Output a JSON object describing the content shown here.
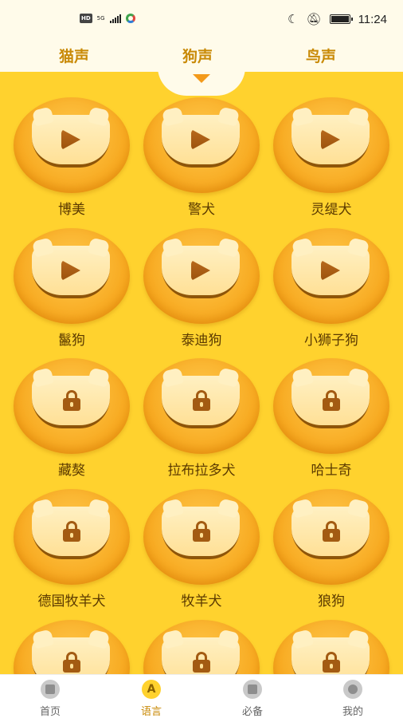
{
  "status_bar": {
    "left_badge": "HD",
    "network": "5G",
    "time": "11:24"
  },
  "tabs": [
    {
      "label": "猫声",
      "active": false
    },
    {
      "label": "狗声",
      "active": true
    },
    {
      "label": "鸟声",
      "active": false
    }
  ],
  "sounds": [
    {
      "label": "博美",
      "icon": "play-icon"
    },
    {
      "label": "警犬",
      "icon": "play-icon"
    },
    {
      "label": "灵缇犬",
      "icon": "play-icon"
    },
    {
      "label": "鬣狗",
      "icon": "play-icon"
    },
    {
      "label": "泰迪狗",
      "icon": "play-icon"
    },
    {
      "label": "小狮子狗",
      "icon": "play-icon"
    },
    {
      "label": "藏獒",
      "icon": "lock-icon"
    },
    {
      "label": "拉布拉多犬",
      "icon": "lock-icon"
    },
    {
      "label": "哈士奇",
      "icon": "lock-icon"
    },
    {
      "label": "德国牧羊犬",
      "icon": "lock-icon"
    },
    {
      "label": "牧羊犬",
      "icon": "lock-icon"
    },
    {
      "label": "狼狗",
      "icon": "lock-icon"
    },
    {
      "label": "",
      "icon": "lock-icon"
    },
    {
      "label": "",
      "icon": "lock-icon"
    },
    {
      "label": "",
      "icon": "lock-icon"
    }
  ],
  "bottom_nav": [
    {
      "label": "首页",
      "icon": "home-icon",
      "active": false
    },
    {
      "label": "语言",
      "icon": "language-icon",
      "active": true,
      "glyph": "A"
    },
    {
      "label": "必备",
      "icon": "essentials-icon",
      "active": false
    },
    {
      "label": "我的",
      "icon": "profile-icon",
      "active": false
    }
  ],
  "colors": {
    "background": "#FFD22E",
    "tab_text": "#C98A07",
    "indicator": "#F39A1A",
    "label_text": "#5B3A00"
  }
}
